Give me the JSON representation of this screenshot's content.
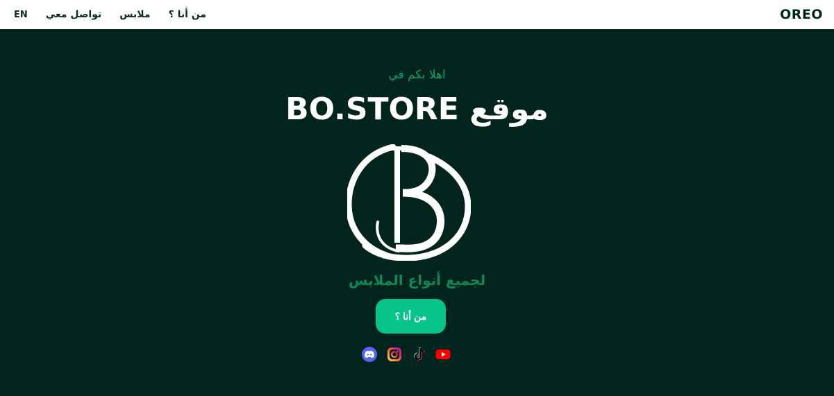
{
  "navbar": {
    "brand": "OREO",
    "links": [
      {
        "label": "EN"
      },
      {
        "label": "تواصل معي"
      },
      {
        "label": "ملابس"
      },
      {
        "label": "من أنا ؟"
      }
    ]
  },
  "hero": {
    "welcome": "اهلا بكم في",
    "title": "موقع BO.STORE",
    "tagline": "لجميع أنواع الملابس",
    "cta_label": "من أنا ؟"
  },
  "socials": [
    {
      "icon": "discord-icon",
      "color": "#5865F2"
    },
    {
      "icon": "instagram-icon",
      "color": "#E1306C"
    },
    {
      "icon": "tiktok-icon",
      "color": "#000000"
    },
    {
      "icon": "youtube-icon",
      "color": "#FF0000"
    }
  ],
  "colors": {
    "background": "#01251c",
    "accent": "#06c48a",
    "accent_text": "#10a36d"
  }
}
